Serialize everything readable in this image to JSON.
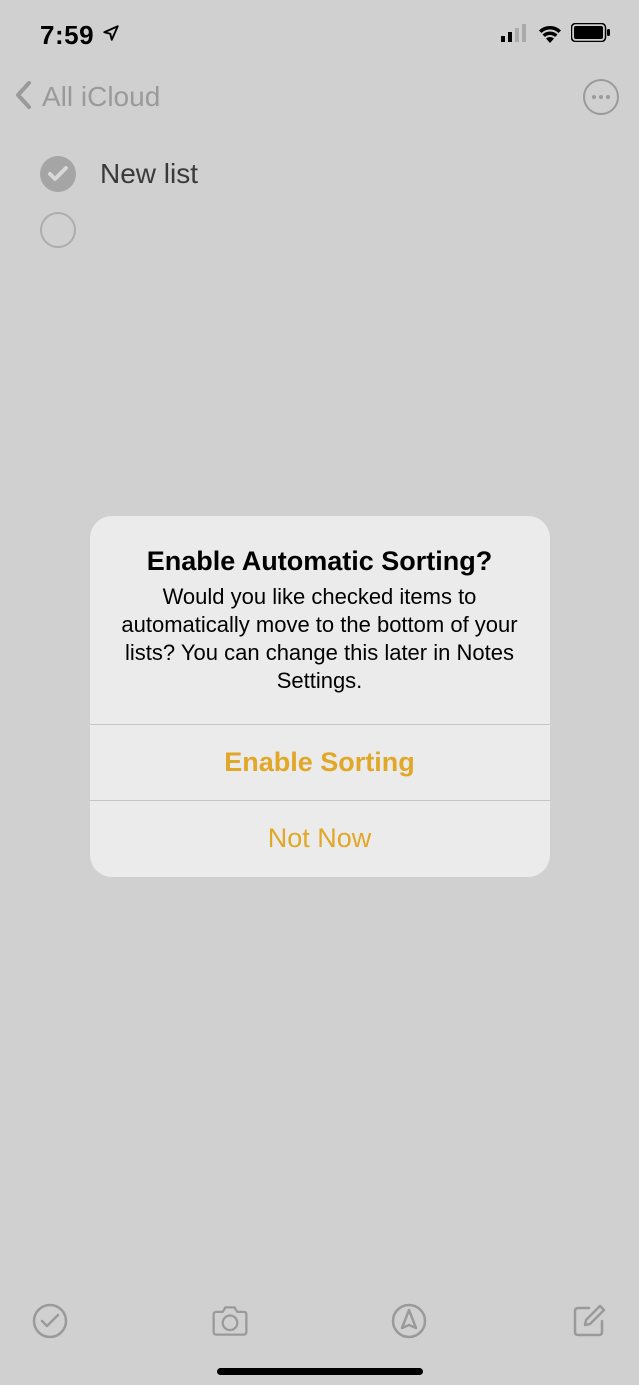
{
  "status": {
    "time": "7:59"
  },
  "nav": {
    "back_label": "All iCloud"
  },
  "content": {
    "items": [
      {
        "label": "New list",
        "checked": true
      },
      {
        "label": "",
        "checked": false
      }
    ]
  },
  "alert": {
    "title": "Enable Automatic Sorting?",
    "message": "Would you like checked items to automatically move to the bottom of your lists? You can change this later in Notes Settings.",
    "primary_button": "Enable Sorting",
    "secondary_button": "Not Now"
  }
}
